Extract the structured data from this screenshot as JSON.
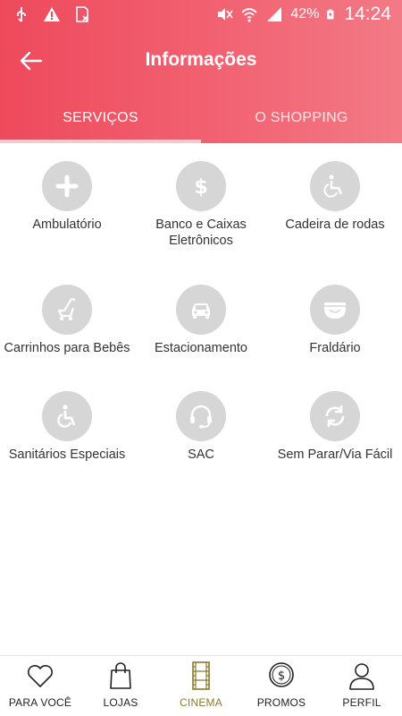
{
  "status_bar": {
    "battery": "42%",
    "time": "14:24",
    "icons": [
      "usb-icon",
      "warning-icon",
      "sim-icon",
      "mute-icon",
      "wifi-icon",
      "signal-icon",
      "battery-charging-icon"
    ]
  },
  "header": {
    "title": "Informações",
    "back_icon": "arrow-left-icon",
    "background_color": "#ee4a5c"
  },
  "tabs": [
    {
      "label": "SERVIÇOS",
      "active": true
    },
    {
      "label": "O SHOPPING",
      "active": false
    }
  ],
  "services": [
    {
      "label": "Ambulatório",
      "icon": "plus-icon"
    },
    {
      "label": "Banco e Caixas Eletrônicos",
      "icon": "dollar-icon"
    },
    {
      "label": "Cadeira de rodas",
      "icon": "wheelchair-icon"
    },
    {
      "label": "Carrinhos para Bebês",
      "icon": "stroller-icon"
    },
    {
      "label": "Estacionamento",
      "icon": "car-icon"
    },
    {
      "label": "Fraldário",
      "icon": "diaper-icon"
    },
    {
      "label": "Sanitários Especiais",
      "icon": "accessible-icon"
    },
    {
      "label": "SAC",
      "icon": "headset-icon"
    },
    {
      "label": "Sem Parar/Via Fácil",
      "icon": "sync-icon"
    }
  ],
  "bottom_nav": [
    {
      "label": "PARA VOCÊ",
      "icon": "heart-icon",
      "active": false
    },
    {
      "label": "LOJAS",
      "icon": "shopping-bag-icon",
      "active": false
    },
    {
      "label": "CINEMA",
      "icon": "film-icon",
      "active": true
    },
    {
      "label": "PROMOS",
      "icon": "coin-icon",
      "active": false
    },
    {
      "label": "PERFIL",
      "icon": "user-icon",
      "active": false
    }
  ],
  "colors": {
    "accent": "#ee4a5c",
    "icon_circle": "#d6d6d6",
    "active_nav": "#8a7a2a"
  }
}
